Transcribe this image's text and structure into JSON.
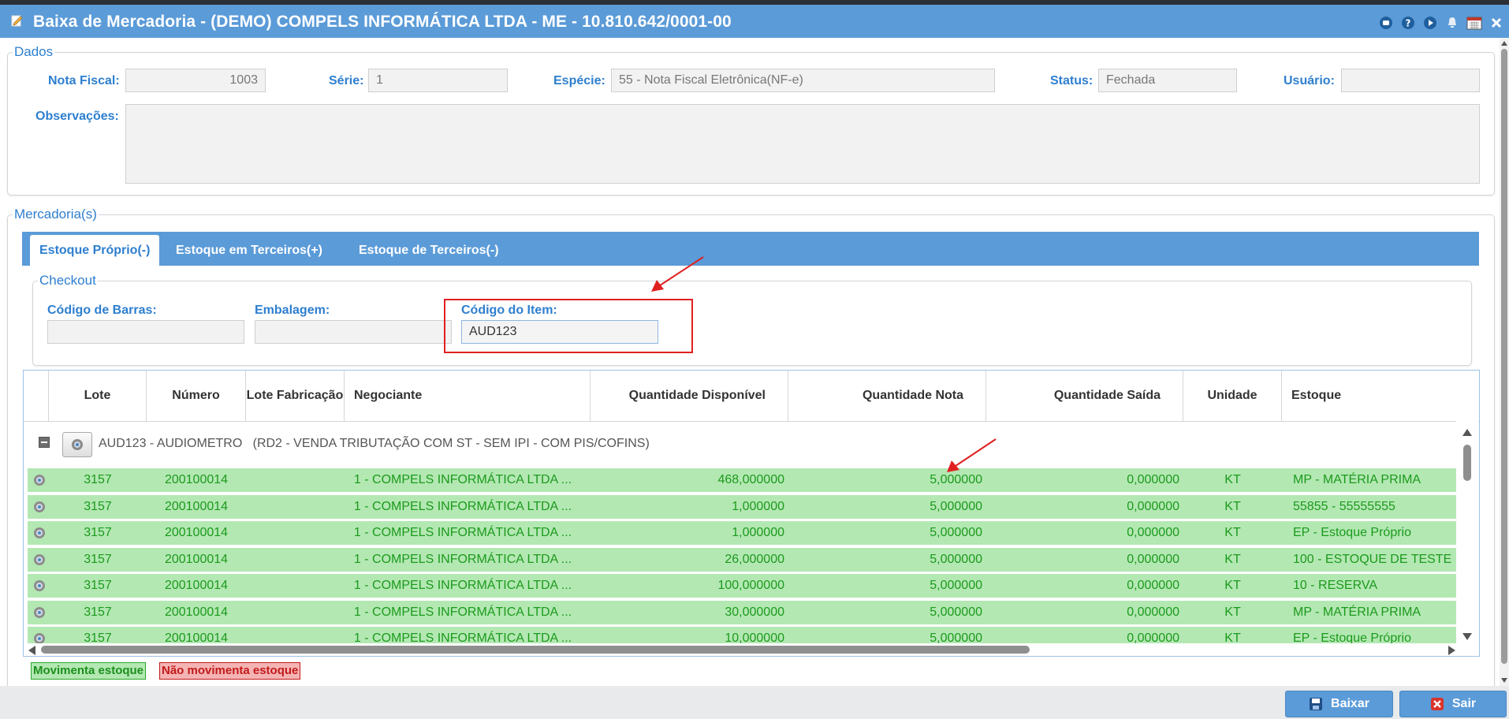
{
  "window": {
    "title": "Baixa de Mercadoria - (DEMO) COMPELS INFORMÁTICA LTDA - ME - 10.810.642/0001-00",
    "icons": [
      "edit-icon",
      "chat-icon",
      "help-icon",
      "play-icon",
      "bell-icon",
      "calendar-icon",
      "close-icon"
    ]
  },
  "dados": {
    "legend": "Dados",
    "nota_fiscal_label": "Nota Fiscal:",
    "nota_fiscal_value": "1003",
    "serie_label": "Série:",
    "serie_value": "1",
    "especie_label": "Espécie:",
    "especie_value": "55 - Nota Fiscal Eletrônica(NF-e)",
    "status_label": "Status:",
    "status_value": "Fechada",
    "usuario_label": "Usuário:",
    "usuario_value": "",
    "observacoes_label": "Observações:"
  },
  "mercadorias": {
    "legend": "Mercadoria(s)",
    "tabs": [
      {
        "label": "Estoque Próprio(-)",
        "active": true
      },
      {
        "label": "Estoque em Terceiros(+)",
        "active": false
      },
      {
        "label": "Estoque de Terceiros(-)",
        "active": false
      }
    ]
  },
  "checkout": {
    "legend": "Checkout",
    "codigo_barras_label": "Código de Barras:",
    "codigo_barras_value": "",
    "embalagem_label": "Embalagem:",
    "embalagem_value": "",
    "codigo_item_label": "Código do Item:",
    "codigo_item_value": "AUD123"
  },
  "grid": {
    "columns": [
      "Lote",
      "Número",
      "Lote Fabricação",
      "Negociante",
      "Quantidade Disponível",
      "Quantidade Nota",
      "Quantidade Saída",
      "Unidade",
      "Estoque"
    ],
    "group": {
      "item": "AUD123 - AUDIOMETRO",
      "description": "(RD2 - VENDA TRIBUTAÇÃO COM ST - SEM IPI - COM PIS/COFINS)"
    },
    "rows": [
      {
        "lote": "3157",
        "numero": "200100014",
        "lote_fab": "",
        "negociante": "1 - COMPELS INFORMÁTICA LTDA ...",
        "qtd_disp": "468,000000",
        "qtd_nota": "5,000000",
        "qtd_saida": "0,000000",
        "unidade": "KT",
        "estoque": "MP - MATÉRIA PRIMA"
      },
      {
        "lote": "3157",
        "numero": "200100014",
        "lote_fab": "",
        "negociante": "1 - COMPELS INFORMÁTICA LTDA ...",
        "qtd_disp": "1,000000",
        "qtd_nota": "5,000000",
        "qtd_saida": "0,000000",
        "unidade": "KT",
        "estoque": "55855 - 55555555"
      },
      {
        "lote": "3157",
        "numero": "200100014",
        "lote_fab": "",
        "negociante": "1 - COMPELS INFORMÁTICA LTDA ...",
        "qtd_disp": "1,000000",
        "qtd_nota": "5,000000",
        "qtd_saida": "0,000000",
        "unidade": "KT",
        "estoque": "EP - Estoque Próprio"
      },
      {
        "lote": "3157",
        "numero": "200100014",
        "lote_fab": "",
        "negociante": "1 - COMPELS INFORMÁTICA LTDA ...",
        "qtd_disp": "26,000000",
        "qtd_nota": "5,000000",
        "qtd_saida": "0,000000",
        "unidade": "KT",
        "estoque": "100 - ESTOQUE DE TESTE"
      },
      {
        "lote": "3157",
        "numero": "200100014",
        "lote_fab": "",
        "negociante": "1 - COMPELS INFORMÁTICA LTDA ...",
        "qtd_disp": "100,000000",
        "qtd_nota": "5,000000",
        "qtd_saida": "0,000000",
        "unidade": "KT",
        "estoque": "10 - RESERVA"
      },
      {
        "lote": "3157",
        "numero": "200100014",
        "lote_fab": "",
        "negociante": "1 - COMPELS INFORMÁTICA LTDA ...",
        "qtd_disp": "30,000000",
        "qtd_nota": "5,000000",
        "qtd_saida": "0,000000",
        "unidade": "KT",
        "estoque": "MP - MATÉRIA PRIMA"
      },
      {
        "lote": "3157",
        "numero": "200100014",
        "lote_fab": "",
        "negociante": "1 - COMPELS INFORMÁTICA LTDA ...",
        "qtd_disp": "10,000000",
        "qtd_nota": "5,000000",
        "qtd_saida": "0,000000",
        "unidade": "KT",
        "estoque": "EP - Estoque Próprio"
      }
    ]
  },
  "legend": {
    "movimenta": "Movimenta estoque",
    "nao_movimenta": "Não movimenta estoque"
  },
  "footer": {
    "baixar_label": "Baixar",
    "sair_label": "Sair"
  },
  "colors": {
    "titlebar": "#5b9bd8",
    "label_blue": "#2e7fd0",
    "row_green": "#b3e8b3",
    "row_text": "#1c9a1c",
    "annotation_red": "#e02020"
  }
}
